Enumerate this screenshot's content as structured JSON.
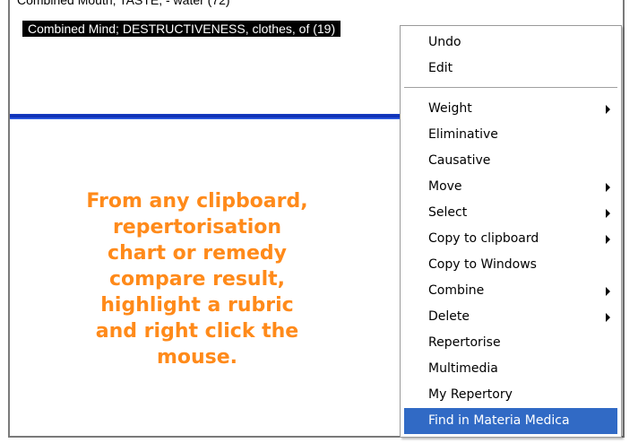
{
  "rubrics": {
    "partial_row": "Combined Mouth; TASTE, - water (72)",
    "selected_row": "Combined Mind; DESTRUCTIVENESS,  clothes, of (19)"
  },
  "instruction": {
    "line1": "From any clipboard,",
    "line2": "repertorisation",
    "line3": "chart or remedy",
    "line4": "compare result,",
    "line5": "highlight a rubric",
    "line6": "and right click the",
    "line7": "mouse."
  },
  "context_menu": {
    "items": [
      {
        "label": "Undo",
        "submenu": false
      },
      {
        "label": "Edit",
        "submenu": false
      },
      {
        "label": "Weight",
        "submenu": true
      },
      {
        "label": "Eliminative",
        "submenu": false
      },
      {
        "label": "Causative",
        "submenu": false
      },
      {
        "label": "Move",
        "submenu": true
      },
      {
        "label": "Select",
        "submenu": true
      },
      {
        "label": "Copy to clipboard",
        "submenu": true
      },
      {
        "label": "Copy to Windows",
        "submenu": false
      },
      {
        "label": "Combine",
        "submenu": true
      },
      {
        "label": "Delete",
        "submenu": true
      },
      {
        "label": "Repertorise",
        "submenu": false
      },
      {
        "label": "Multimedia",
        "submenu": false
      },
      {
        "label": "My Repertory",
        "submenu": false
      },
      {
        "label": "Find in Materia Medica",
        "submenu": false,
        "highlighted": true
      }
    ]
  },
  "colors": {
    "instruction_text": "#ff8a1a",
    "menu_highlight": "#316ac5",
    "divider": "#1a3fc4"
  }
}
